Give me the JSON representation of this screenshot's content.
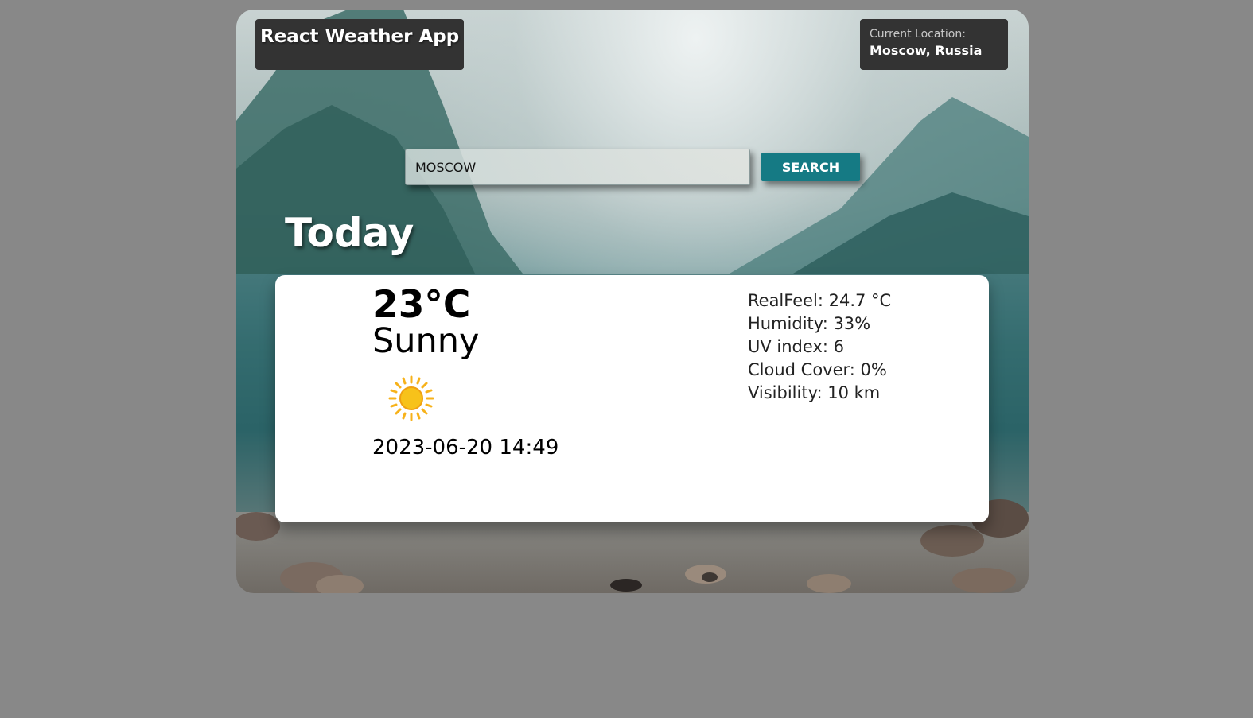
{
  "app": {
    "title": "React Weather App"
  },
  "location": {
    "label": "Current Location:",
    "value": "Moscow, Russia"
  },
  "search": {
    "value": "MOSCOW",
    "button_label": "SEARCH"
  },
  "today": {
    "heading": "Today",
    "temperature": "23°C",
    "condition": "Sunny",
    "icon": "sun-icon",
    "datetime": "2023-06-20 14:49",
    "details": [
      "RealFeel: 24.7 °C",
      "Humidity: 33%",
      "UV index: 6",
      "Cloud Cover: 0%",
      "Visibility: 10 km"
    ]
  },
  "colors": {
    "page_background": "#888888",
    "header_box": "#333333",
    "search_button": "#157a84",
    "card": "#ffffff",
    "sun": "#f7c21a"
  }
}
